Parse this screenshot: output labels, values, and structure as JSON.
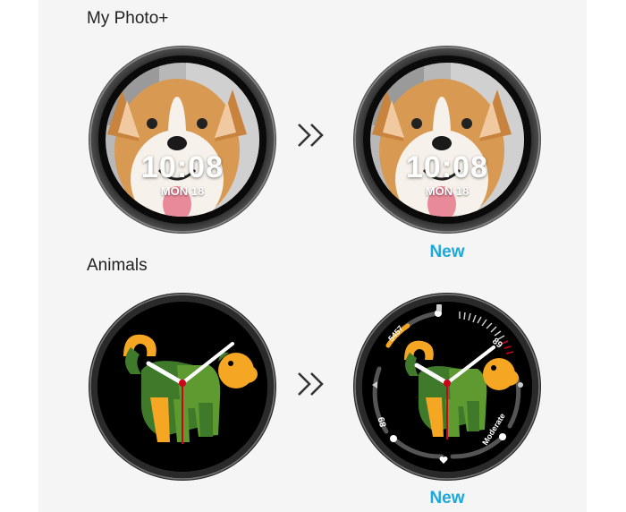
{
  "sections": [
    {
      "title": "My Photo+",
      "before": {
        "time": "10:08",
        "date": "MON 18"
      },
      "after": {
        "time": "10:08",
        "date": "MON 18"
      },
      "new_label": "New"
    },
    {
      "title": "Animals",
      "after": {
        "step_value": "5457",
        "heart_rate": "89",
        "battery": "89",
        "uv_status": "Moderate"
      },
      "new_label": "New"
    }
  ],
  "transition_icon": "double-chevron-right-icon",
  "colors": {
    "accent": "#1aa9dc",
    "animal_orange": "#f5a623",
    "animal_green": "#3f7a2b",
    "animal_lightgreen": "#5e9a30"
  }
}
